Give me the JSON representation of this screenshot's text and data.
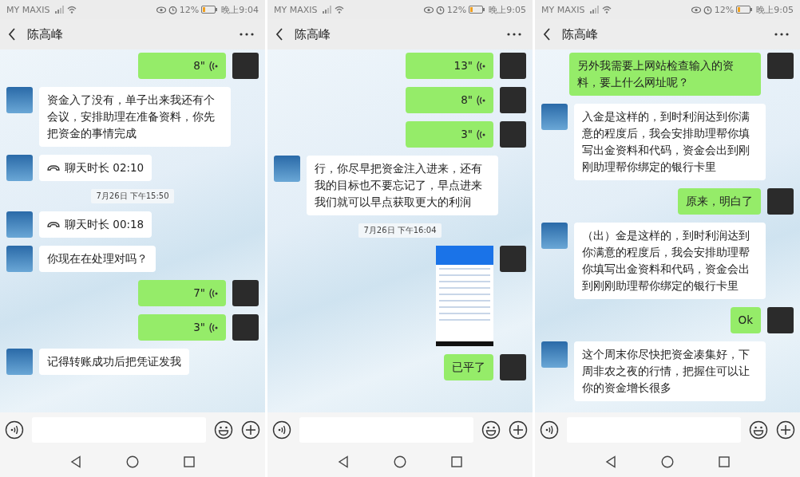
{
  "panels": [
    {
      "status_bar": {
        "carrier": "MY MAXIS",
        "battery": "12%",
        "time": "晚上9:04"
      },
      "header": {
        "title": "陈高峰"
      },
      "messages": [
        {
          "kind": "voice",
          "outgoing": true,
          "text": "8\""
        },
        {
          "kind": "text",
          "outgoing": false,
          "text": "资金入了没有，单子出来我还有个会议，安排助理在准备资料，你先把资金的事情完成"
        },
        {
          "kind": "call",
          "outgoing": false,
          "text": "聊天时长 02:10"
        },
        {
          "kind": "time",
          "text": "7月26日 下午15:50"
        },
        {
          "kind": "call",
          "outgoing": false,
          "text": "聊天时长 00:18"
        },
        {
          "kind": "text",
          "outgoing": false,
          "text": "你现在在处理对吗？"
        },
        {
          "kind": "voice",
          "outgoing": true,
          "text": "7\""
        },
        {
          "kind": "voice",
          "outgoing": true,
          "text": "3\""
        },
        {
          "kind": "text",
          "outgoing": false,
          "text": "记得转账成功后把凭证发我"
        }
      ]
    },
    {
      "status_bar": {
        "carrier": "MY MAXIS",
        "battery": "12%",
        "time": "晚上9:05"
      },
      "header": {
        "title": "陈高峰"
      },
      "messages": [
        {
          "kind": "voice",
          "outgoing": true,
          "text": "13\""
        },
        {
          "kind": "voice",
          "outgoing": true,
          "text": "8\""
        },
        {
          "kind": "voice",
          "outgoing": true,
          "text": "3\""
        },
        {
          "kind": "text",
          "outgoing": false,
          "text": "行，你尽早把资金注入进来，还有我的目标也不要忘记了，早点进来我们就可以早点获取更大的利润"
        },
        {
          "kind": "time",
          "text": "7月26日 下午16:04"
        },
        {
          "kind": "image",
          "outgoing": true
        },
        {
          "kind": "text",
          "outgoing": true,
          "text": "已平了"
        }
      ]
    },
    {
      "status_bar": {
        "carrier": "MY MAXIS",
        "battery": "12%",
        "time": "晚上9:05"
      },
      "header": {
        "title": "陈高峰"
      },
      "messages": [
        {
          "kind": "text",
          "outgoing": true,
          "text": "另外我需要上网站检查输入的资料，要上什么网址呢？"
        },
        {
          "kind": "text",
          "outgoing": false,
          "text": "入金是这样的，到时利润达到你满意的程度后，我会安排助理帮你填写出金资料和代码，资金会出到刚刚助理帮你绑定的银行卡里"
        },
        {
          "kind": "text",
          "outgoing": true,
          "text": "原来，明白了"
        },
        {
          "kind": "text",
          "outgoing": false,
          "text": "（出）金是这样的，到时利润达到你满意的程度后，我会安排助理帮你填写出金资料和代码，资金会出到刚刚助理帮你绑定的银行卡里"
        },
        {
          "kind": "text",
          "outgoing": true,
          "text": "Ok"
        },
        {
          "kind": "text",
          "outgoing": false,
          "text": "这个周末你尽快把资金凑集好，下周非农之夜的行情，把握住可以让你的资金增长很多"
        }
      ]
    }
  ]
}
